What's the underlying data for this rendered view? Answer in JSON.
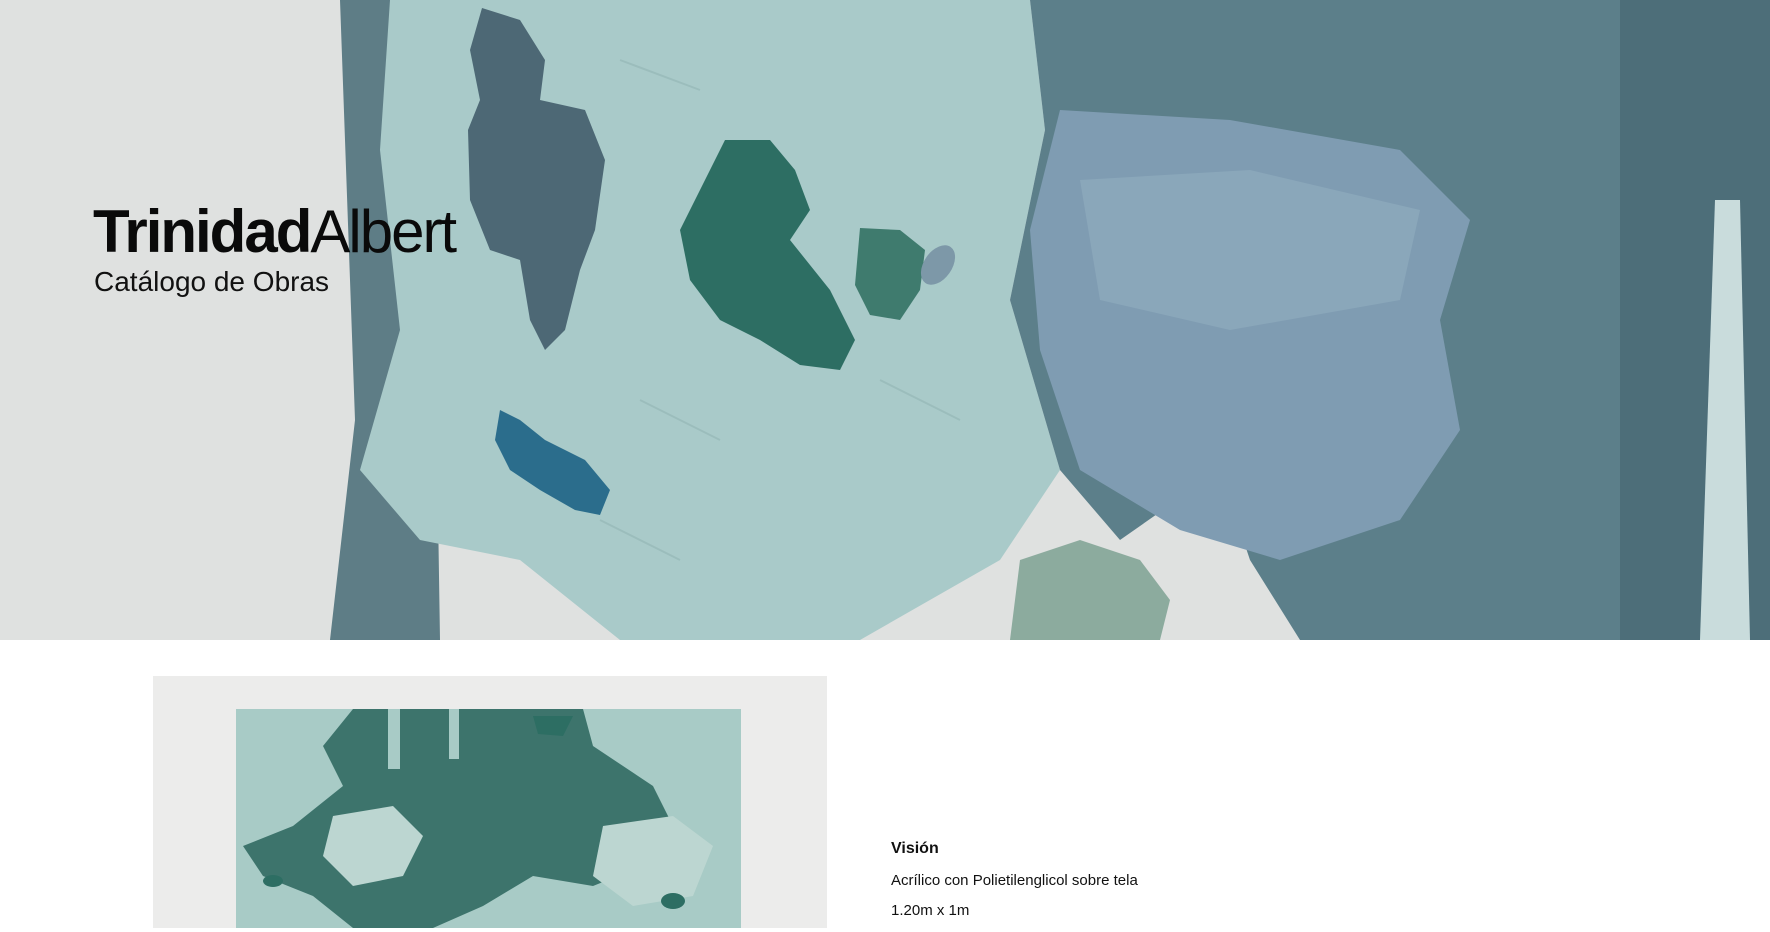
{
  "header": {
    "brand_first": "Trinidad",
    "brand_last": "Albert",
    "subtitle": "Catálogo de Obras"
  },
  "artwork": {
    "title": "Visión",
    "technique": "Acrílico con Polietilenglicol sobre tela",
    "dimensions": "1.20m x 1m"
  },
  "colors": {
    "ink": "#0a0a0a",
    "wall": "#dcdedd",
    "paint_light": "#a9cac8",
    "paint_teal": "#2c6f64",
    "paint_slate": "#4f6f7e",
    "paint_blue": "#7f9cb1",
    "paint_deep_blue": "#2b6d8c"
  }
}
